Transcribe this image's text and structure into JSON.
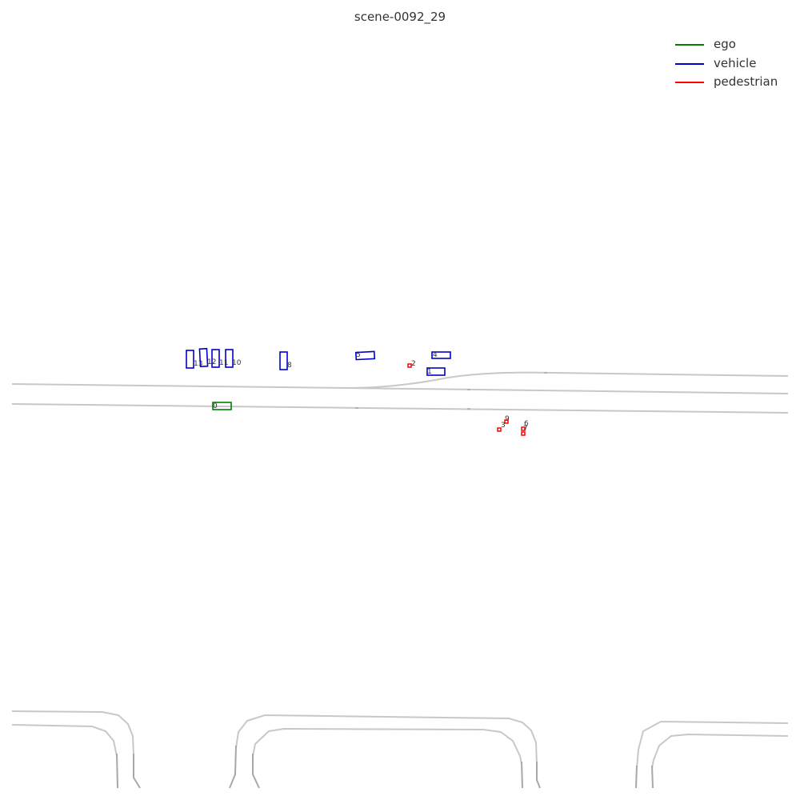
{
  "title": "scene-0092_29",
  "legend": [
    {
      "label": "ego",
      "color": "#008000"
    },
    {
      "label": "vehicle",
      "color": "#0000cc"
    },
    {
      "label": "pedestrian",
      "color": "#ff0000"
    }
  ],
  "agents": [
    {
      "id": "0",
      "type": "ego"
    },
    {
      "id": "1",
      "type": "vehicle"
    },
    {
      "id": "2",
      "type": "pedestrian"
    },
    {
      "id": "3",
      "type": "pedestrian"
    },
    {
      "id": "4",
      "type": "vehicle"
    },
    {
      "id": "5",
      "type": "vehicle"
    },
    {
      "id": "6",
      "type": "pedestrian"
    },
    {
      "id": "7",
      "type": "pedestrian"
    },
    {
      "id": "8",
      "type": "vehicle"
    },
    {
      "id": "9",
      "type": "pedestrian"
    },
    {
      "id": "10",
      "type": "vehicle"
    },
    {
      "id": "11",
      "type": "vehicle"
    },
    {
      "id": "12",
      "type": "vehicle"
    },
    {
      "id": "13",
      "type": "vehicle"
    }
  ],
  "colors": {
    "lane": "#c8c8c8",
    "lane_dark": "#a8a8a8",
    "text": "#333333"
  }
}
